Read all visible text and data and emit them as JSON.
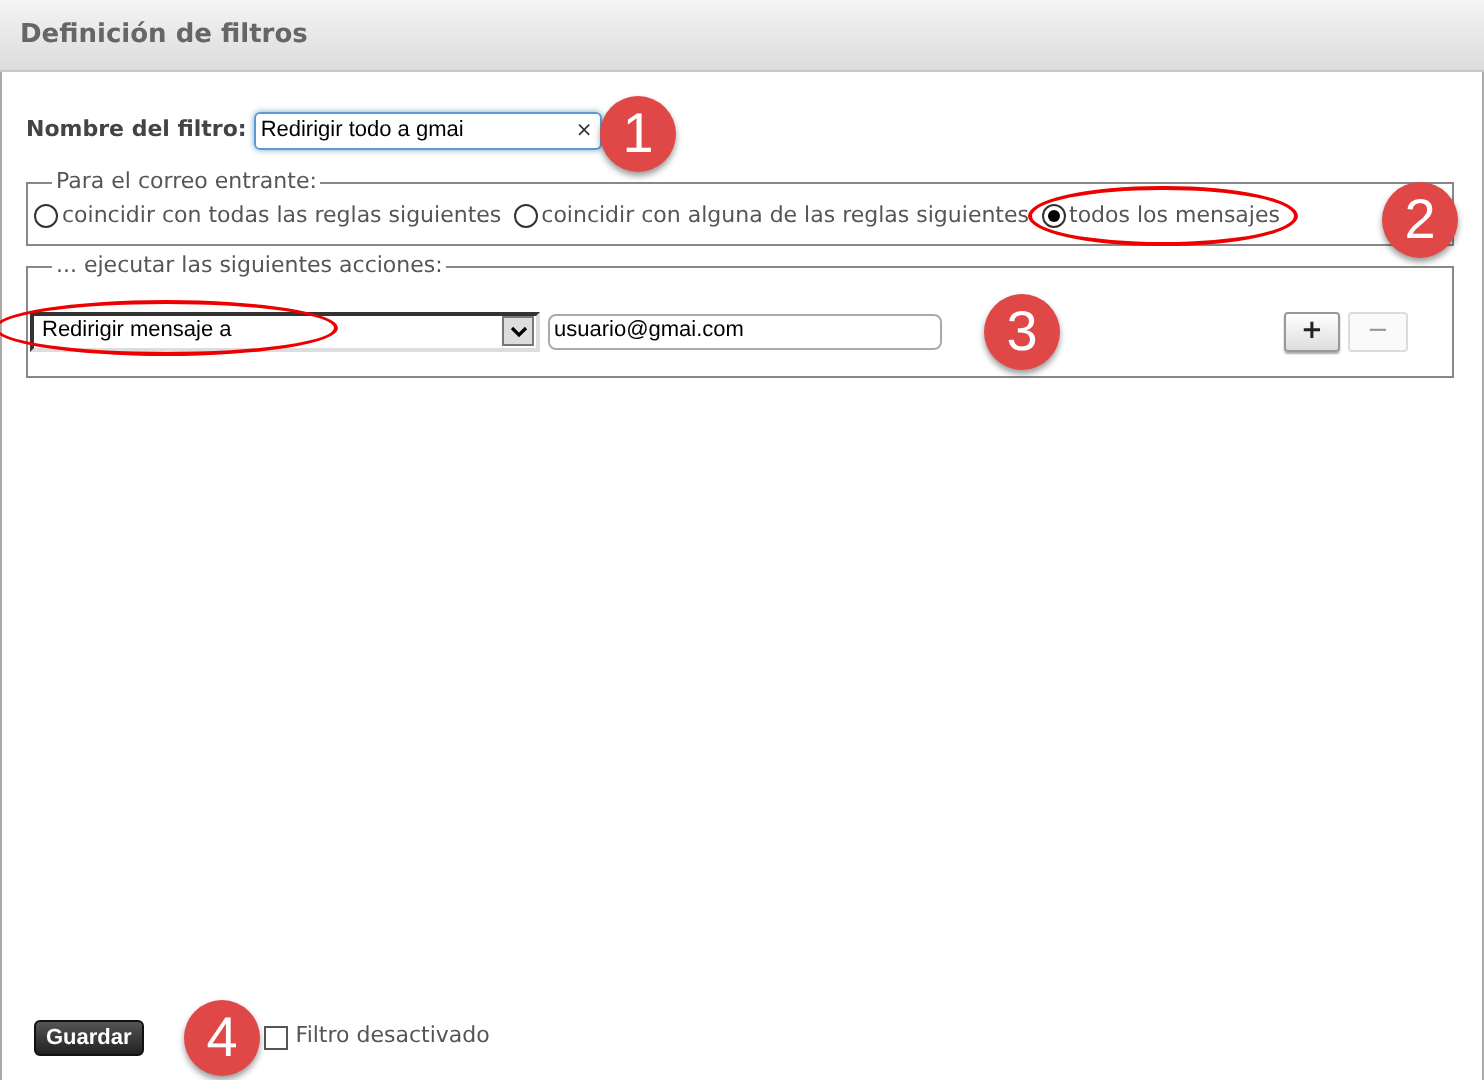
{
  "window": {
    "title": "Definición de filtros"
  },
  "filter_name": {
    "label": "Nombre del filtro:",
    "value": "Redirigir todo a gmai",
    "clear": "×"
  },
  "incoming": {
    "legend": "Para el correo entrante:",
    "options": [
      {
        "label": "coincidir con todas las reglas siguientes",
        "selected": false
      },
      {
        "label": "coincidir con alguna de las reglas siguientes",
        "selected": false
      },
      {
        "label": "todos los mensajes",
        "selected": true
      }
    ]
  },
  "actions": {
    "legend": "... ejecutar las siguientes acciones:",
    "rows": [
      {
        "action": "Redirigir mensaje a",
        "target": "usuario@gmai.com",
        "add": "+",
        "remove": "−",
        "remove_disabled": true
      }
    ]
  },
  "footer": {
    "save": "Guardar",
    "disabled_filter": {
      "label": "Filtro desactivado",
      "checked": false
    }
  },
  "annotations": [
    "1",
    "2",
    "3",
    "4"
  ]
}
